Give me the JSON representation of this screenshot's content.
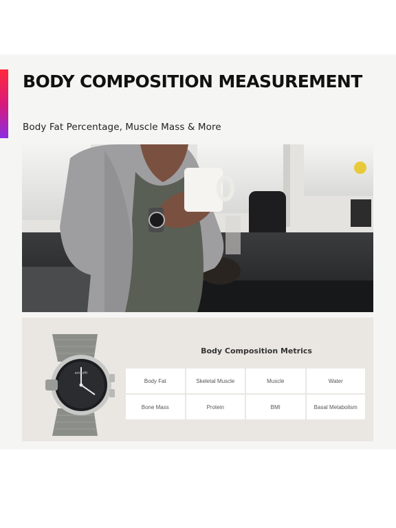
{
  "header": {
    "title": "BODY COMPOSITION MEASUREMENT",
    "subtitle": "Body Fat Percentage, Muscle Mass & More"
  },
  "photo": {
    "subject": "woman-holding-mug-wearing-smartwatch"
  },
  "metrics": {
    "title": "Body Composition Metrics",
    "items": [
      "Body Fat",
      "Skeletal Muscle",
      "Muscle",
      "Water",
      "Bone Mass",
      "Protein",
      "BMI",
      "Basal Metabolism"
    ]
  },
  "watch": {
    "brand": "Amazfit"
  },
  "colors": {
    "accent_top": "#ff2a3d",
    "accent_bottom": "#8a2be2",
    "panel": "#f5f5f4",
    "card": "#eae7e3"
  }
}
